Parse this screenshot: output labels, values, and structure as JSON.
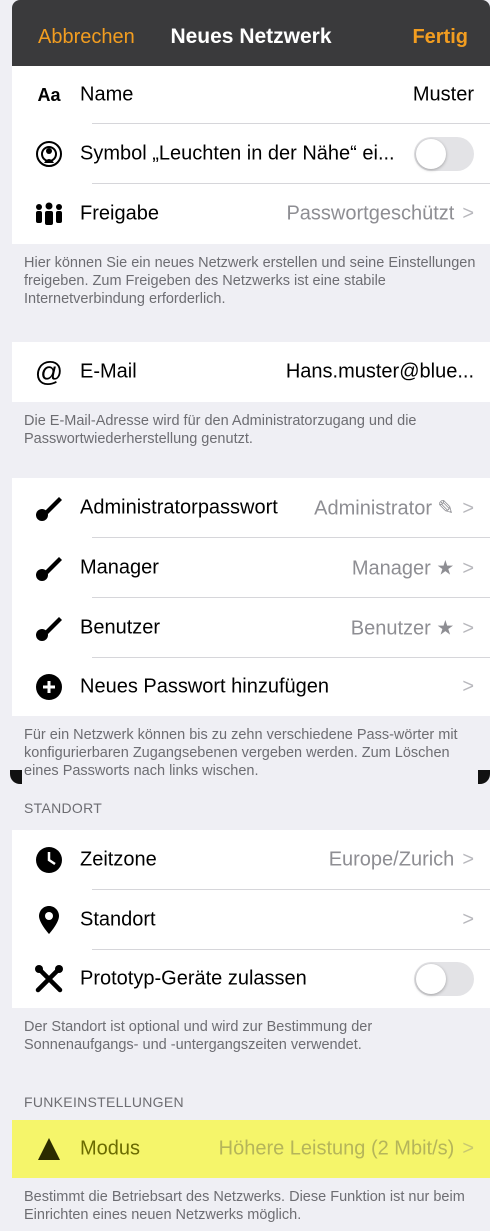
{
  "nav": {
    "cancel": "Abbrechen",
    "title": "Neues Netzwerk",
    "done": "Fertig"
  },
  "rows1": {
    "name_icon": "Aa",
    "name_label": "Name",
    "name_value": "Muster",
    "beacon_label": "Symbol „Leuchten in der Nähe“ ei...",
    "beacon_toggle": "off",
    "share_label": "Freigabe",
    "share_value": "Passwortgeschützt"
  },
  "note1": "Hier können Sie ein neues Netzwerk erstellen und seine Einstellungen freigeben. Zum Freigeben des Netzwerks ist eine stabile Internetverbindung erforderlich.",
  "email": {
    "label": "E-Mail",
    "value": "Hans.muster@blue..."
  },
  "note2": "Die E-Mail-Adresse wird für den Administratorzugang und die Passwortwiederherstellung genutzt.",
  "passwords": {
    "admin_label": "Administratorpasswort",
    "admin_value": "Administrator ✎",
    "manager_label": "Manager",
    "manager_value": "Manager ★",
    "user_label": "Benutzer",
    "user_value": "Benutzer ★",
    "add_label": "Neues Passwort hinzufügen"
  },
  "note3": "Für ein Netzwerk können bis zu zehn verschiedene Pass-wörter mit konfigurierbaren Zugangsebenen vergeben werden. Zum Löschen eines Passworts nach links wischen.",
  "location_header": "STANDORT",
  "location": {
    "tz_label": "Zeitzone",
    "tz_value": "Europe/Zurich",
    "loc_label": "Standort",
    "proto_label": "Prototyp-Geräte zulassen",
    "proto_toggle": "off"
  },
  "note4": "Der Standort ist optional und wird zur Bestimmung der Sonnenaufgangs- und -untergangszeiten verwendet.",
  "radio_header": "FUNKEINSTELLUNGEN",
  "radio": {
    "mode_label": "Modus",
    "mode_value": "Höhere Leistung (2 Mbit/s)",
    "highlight": "#f5f56a"
  },
  "note5": "Bestimmt die Betriebsart des Netzwerks. Diese Funktion ist nur beim Einrichten eines neuen Netzwerks möglich.",
  "chevron": ">",
  "colors": {
    "accent": "#f29d20",
    "secondary": "#8e8e93"
  }
}
